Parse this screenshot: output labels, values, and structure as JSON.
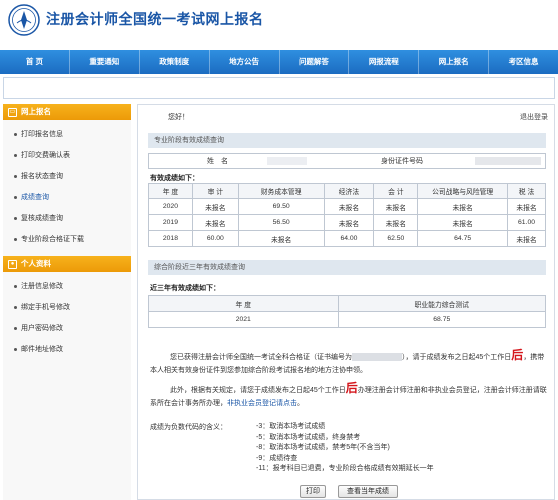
{
  "header": {
    "site_title": "注册会计师全国统一考试网上报名"
  },
  "nav": [
    "首 页",
    "重要通知",
    "政策制度",
    "地方公告",
    "问题解答",
    "网报流程",
    "网上报名",
    "考区信息"
  ],
  "sidebar": {
    "section1_title": "网上报名",
    "section1_items": [
      "打印报名信息",
      "打印交费确认表",
      "报名状态查询",
      "成绩查询",
      "复核成绩查询",
      "专业阶段合格证下载"
    ],
    "section2_title": "个人资料",
    "section2_items": [
      "注册信息修改",
      "绑定手机号修改",
      "用户密码修改",
      "邮件地址修改"
    ]
  },
  "main": {
    "greeting": "您好！",
    "logout": "退出登录",
    "section_pro": "专业阶段有效成绩查询",
    "name_label": "姓　名",
    "id_label": "身份证件号码",
    "valid_scores_title": "有效成绩如下：",
    "pro_table": {
      "headers": [
        "年 度",
        "审 计",
        "财务成本管理",
        "经济法",
        "会 计",
        "公司战略与风险管理",
        "税 法"
      ],
      "rows": [
        [
          "2020",
          "未报名",
          "69.50",
          "未报名",
          "未报名",
          "未报名",
          "未报名"
        ],
        [
          "2019",
          "未报名",
          "56.50",
          "未报名",
          "未报名",
          "未报名",
          "61.00"
        ],
        [
          "2018",
          "60.00",
          "未报名",
          "64.00",
          "62.50",
          "64.75",
          "未报名"
        ]
      ]
    },
    "section_comp": "综合阶段近三年有效成绩查询",
    "comp_title": "近三年有效成绩如下：",
    "comp_table": {
      "headers": [
        "年 度",
        "职业能力综合测试"
      ],
      "rows": [
        [
          "2021",
          "68.75"
        ]
      ]
    },
    "para1_a": "您已获得注册会计师全国统一考试全科合格证（证书编号为",
    "para1_b": "），请于成绩发布之日起45个工作日",
    "para1_red": "后",
    "para1_c": "，携带本人相关有效身份证件到您参加综合阶段考试报名地的地方注协申领。",
    "para2_a": "此外，根据有关规定，请您于成绩发布之日起45个工作日",
    "para2_red": "后",
    "para2_b": "办理注册会计师注册和非执业会员登记，注册会计师注册请联系所在会计事务所办理，",
    "para2_link": "非执业会员登记请点击",
    "para2_end": "。",
    "codes_title": "成绩为负数代码的含义：",
    "codes": [
      "-3：取消本场考试成绩",
      "-5：取消本场考试成绩，终身禁考",
      "-8：取消本场考试成绩，禁考5年(不含当年)",
      "-9：成绩待查",
      "-11：报考科目已退费，专业阶段合格成绩有效期延长一年"
    ],
    "print_button": "打印",
    "view_button": "查看当年成绩"
  }
}
